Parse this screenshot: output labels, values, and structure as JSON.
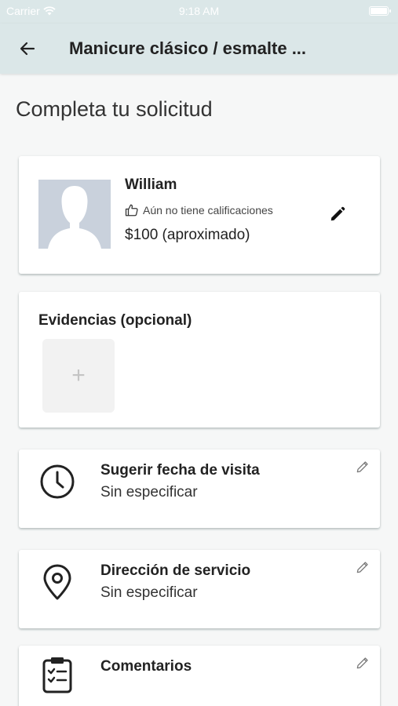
{
  "status_bar": {
    "carrier": "Carrier",
    "time": "9:18 AM"
  },
  "app_bar": {
    "title": "Manicure clásico / esmalte ..."
  },
  "page": {
    "heading": "Completa tu solicitud"
  },
  "provider_card": {
    "name": "William",
    "rating_text": "Aún no tiene calificaciones",
    "price": "$100 (aproximado)"
  },
  "evidence_card": {
    "title": "Evidencias (opcional)",
    "add_symbol": "+"
  },
  "visit_date_card": {
    "title": "Sugerir fecha de visita",
    "value": "Sin especificar"
  },
  "address_card": {
    "title": "Dirección de servicio",
    "value": "Sin especificar"
  },
  "comments_card": {
    "title": "Comentarios"
  },
  "icons": {
    "back": "arrow-left",
    "rating": "thumbs-up",
    "edit": "pencil",
    "date": "clock",
    "address": "map-pin",
    "comments": "clipboard-checklist",
    "wifi": "wifi",
    "battery": "battery"
  },
  "colors": {
    "app_bar": "#dbe7e8",
    "background": "#f6f7f7",
    "avatar_placeholder": "#c9d1dc"
  }
}
